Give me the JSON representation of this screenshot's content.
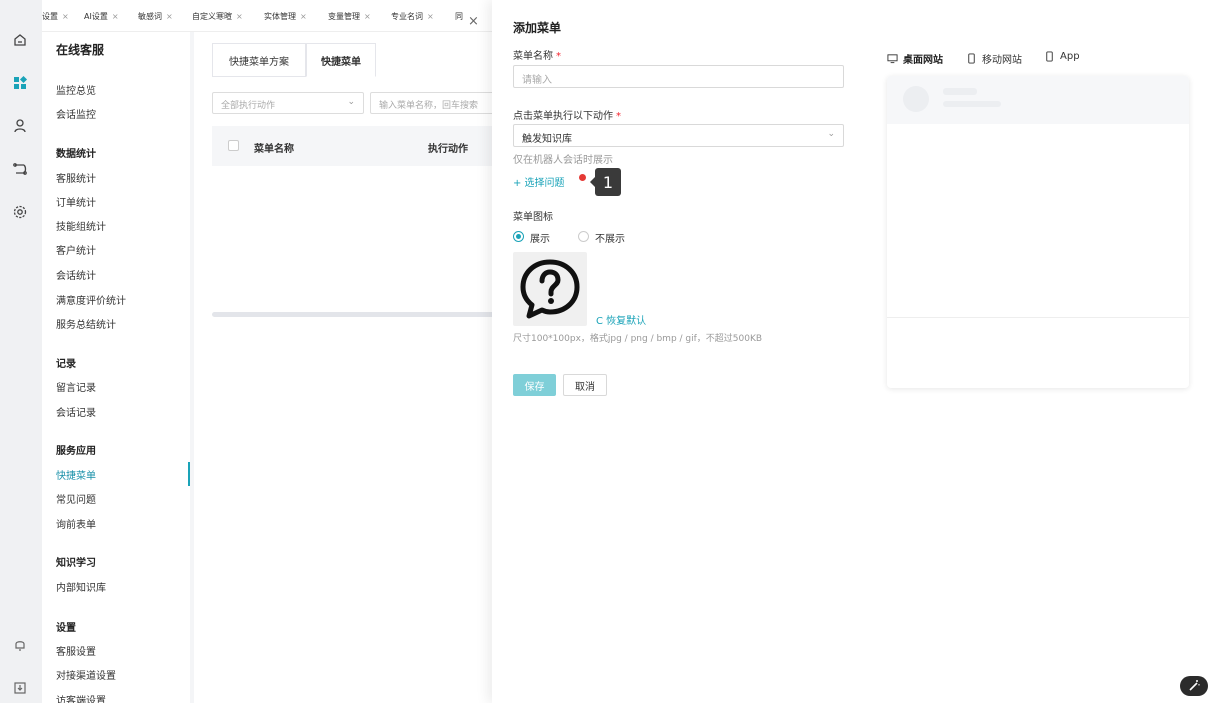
{
  "tabs": [
    {
      "label": "设置"
    },
    {
      "label": "AI设置"
    },
    {
      "label": "敏感词"
    },
    {
      "label": "自定义寒暄"
    },
    {
      "label": "实体管理"
    },
    {
      "label": "变量管理"
    },
    {
      "label": "专业名词"
    },
    {
      "label": "同"
    }
  ],
  "tab_close": "×",
  "sidebar": {
    "title": "在线客服",
    "items": [
      {
        "label": "监控总览"
      },
      {
        "label": "会话监控"
      },
      {
        "label": "数据统计"
      },
      {
        "label": "客服统计"
      },
      {
        "label": "订单统计"
      },
      {
        "label": "技能组统计"
      },
      {
        "label": "客户统计"
      },
      {
        "label": "会话统计"
      },
      {
        "label": "满意度评价统计"
      },
      {
        "label": "服务总结统计"
      },
      {
        "label": "记录"
      },
      {
        "label": "留言记录"
      },
      {
        "label": "会话记录"
      },
      {
        "label": "服务应用"
      },
      {
        "label": "快捷菜单"
      },
      {
        "label": "常见问题"
      },
      {
        "label": "询前表单"
      },
      {
        "label": "知识学习"
      },
      {
        "label": "内部知识库"
      },
      {
        "label": "设置"
      },
      {
        "label": "客服设置"
      },
      {
        "label": "对接渠道设置"
      },
      {
        "label": "访客端设置"
      }
    ]
  },
  "background": {
    "tab_scheme": "快捷菜单方案",
    "tab_menu": "快捷菜单",
    "filter_placeholder": "全部执行动作",
    "search_placeholder": "输入菜单名称，回车搜索",
    "col_name": "菜单名称",
    "col_action": "执行动作",
    "close": "×"
  },
  "drawer": {
    "title": "添加菜单",
    "name_label": "菜单名称",
    "required_mark": "*",
    "name_placeholder": "请输入",
    "action_label": "点击菜单执行以下动作",
    "action_value": "触发知识库",
    "action_hint": "仅在机器人会话时展示",
    "select_question": "+ 选择问题",
    "badge": "1",
    "icon_label": "菜单图标",
    "radio_show": "展示",
    "radio_hide": "不展示",
    "radio_selected": "展示",
    "restore_default": "C 恢复默认",
    "size_hint": "尺寸100*100px，格式jpg / png / bmp / gif，不超过500KB",
    "save": "保存",
    "cancel": "取消"
  },
  "preview": {
    "tabs": [
      {
        "label": "桌面网站",
        "icon": "monitor-icon"
      },
      {
        "label": "移动网站",
        "icon": "mobile-icon"
      },
      {
        "label": "App",
        "icon": "mobile-icon"
      }
    ],
    "selected": "桌面网站"
  },
  "colors": {
    "accent": "#1aa3b8",
    "required": "#f5222d",
    "save_disabled": "#7fcfd8"
  }
}
